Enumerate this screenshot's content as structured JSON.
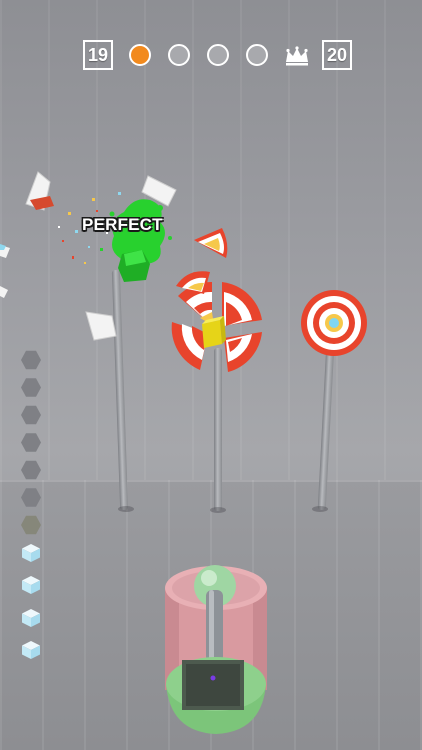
{
  "hud": {
    "current_level": "19",
    "next_level": "20",
    "stage_dots": [
      {
        "state": "current",
        "color": "#f28a1e"
      },
      {
        "state": "pending",
        "color": "#a8a9ad"
      },
      {
        "state": "pending",
        "color": "#a8a9ad"
      },
      {
        "state": "pending",
        "color": "#a8a9ad"
      }
    ],
    "boss_icon": "crown-icon"
  },
  "feedback": {
    "label": "PERFECT"
  },
  "targets": [
    {
      "name": "shattered-target",
      "state": "broken",
      "ring_colors": [
        "#e8442c",
        "#ffffff",
        "#f6c84b"
      ]
    },
    {
      "name": "middle-target",
      "state": "cracking",
      "ring_colors": [
        "#e8442c",
        "#ffffff",
        "#f6c84b"
      ]
    },
    {
      "name": "right-target",
      "state": "intact",
      "ring_colors": [
        "#e8442c",
        "#ffffff",
        "#f6c84b",
        "#7fd6f2"
      ]
    }
  ],
  "ammo": {
    "used_count": 7,
    "remaining_count": 4,
    "used_icon": "hexagon-icon",
    "remaining_icon": "cube-icon"
  },
  "launcher": {
    "body_color": "#d99aa0",
    "base_color": "#8ed08c"
  },
  "colors": {
    "accent": "#f28a1e",
    "hit_splash": "#28d12e",
    "projectile": "#f0e020"
  }
}
